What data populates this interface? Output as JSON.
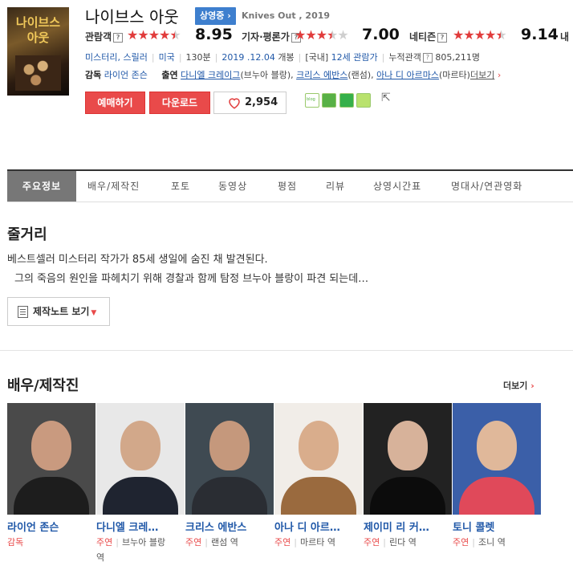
{
  "movie": {
    "poster_title": "나이브스 아웃",
    "title": "나이브스 아웃",
    "status_badge": "상영중 ›",
    "original_title": "Knives Out , 2019"
  },
  "ratings": {
    "audience": {
      "label": "관람객",
      "help": "?",
      "score": "8.95",
      "stars": 4.5
    },
    "critics": {
      "label": "기자·평론가",
      "help": "?",
      "score": "7.00",
      "stars": 3.5
    },
    "netizen": {
      "label": "네티즌",
      "help": "?",
      "score": "9.14",
      "stars": 4.5
    },
    "my": {
      "label": "내"
    }
  },
  "meta": {
    "genre": "미스터리, 스릴러",
    "country": "미국",
    "runtime": "130분",
    "release_date": "2019 .12.04",
    "release_label": "개봉",
    "rating_prefix": "[국내]",
    "rating": "12세 관람가",
    "cumulative_label": "누적관객",
    "cumulative_help": "?",
    "cumulative_value": "805,211명"
  },
  "credits": {
    "director_label": "감독",
    "director": "라이언 존슨",
    "cast_label": "출연",
    "cast_1": "다니엘 크레이그",
    "cast_1_role": "(브누아 블랑),",
    "cast_2": "크리스 에반스",
    "cast_2_role": "(랜섬),",
    "cast_3": "아나 디 아르마스",
    "cast_3_role": "(마르타)",
    "more": "더보기"
  },
  "actions": {
    "reserve": "예매하기",
    "download": "다운로드",
    "like_count": "2,954",
    "share_labels": [
      "blog",
      "cafe",
      "me",
      "band"
    ]
  },
  "tabs": [
    "주요정보",
    "배우/제작진",
    "포토",
    "동영상",
    "평점",
    "리뷰",
    "상영시간표",
    "명대사/연관영화"
  ],
  "synopsis": {
    "heading": "줄거리",
    "line1": "베스트셀러 미스터리 작가가 85세 생일에 숨진 채 발견된다.",
    "line2": "그의 죽음의 원인을 파헤치기 위해 경찰과 함께 탐정 브누아 블랑이 파견 되는데…",
    "note_button": "제작노트 보기"
  },
  "cast_section": {
    "heading": "배우/제작진",
    "more": "더보기",
    "people": [
      {
        "name": "라이언 존슨",
        "type": "감독",
        "role": ""
      },
      {
        "name": "다니엘 크레…",
        "type": "주연",
        "role": "브누아 블랑",
        "role_wrap": "역"
      },
      {
        "name": "크리스 에반스",
        "type": "주연",
        "role": "랜섬 역"
      },
      {
        "name": "아나 디 아르…",
        "type": "주연",
        "role": "마르타 역"
      },
      {
        "name": "제이미 리 커…",
        "type": "주연",
        "role": "린다 역"
      },
      {
        "name": "토니 콜렛",
        "type": "주연",
        "role": "조니 역"
      }
    ]
  },
  "colors": {
    "accent_red": "#e94a4a",
    "link_blue": "#2058a8",
    "badge_blue": "#3e7fce",
    "star_red": "#e13b3b"
  }
}
